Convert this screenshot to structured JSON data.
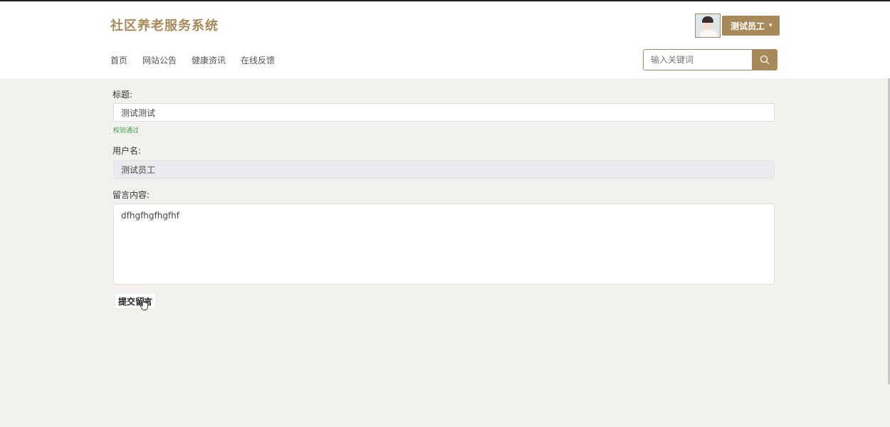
{
  "header": {
    "brand": "社区养老服务系统",
    "user_name": "测试员工",
    "caret": "▾",
    "nav": [
      "首页",
      "网站公告",
      "健康资讯",
      "在线反馈"
    ],
    "search_placeholder": "输入关键词"
  },
  "form": {
    "title_label": "标题:",
    "title_value": "测试测试",
    "validation_text": "校验通过",
    "username_label": "用户名:",
    "username_value": "测试员工",
    "content_label": "留言内容:",
    "content_value": "dfhgfhgfhgfhf",
    "submit_label": "提交留言"
  },
  "colors": {
    "accent": "#a8895a",
    "background": "#f2f1ed",
    "valid": "#3c9a4a"
  },
  "icons": {
    "search": "search-icon",
    "avatar": "avatar",
    "caret": "chevron-down-icon",
    "cursor": "hand-cursor-icon"
  }
}
